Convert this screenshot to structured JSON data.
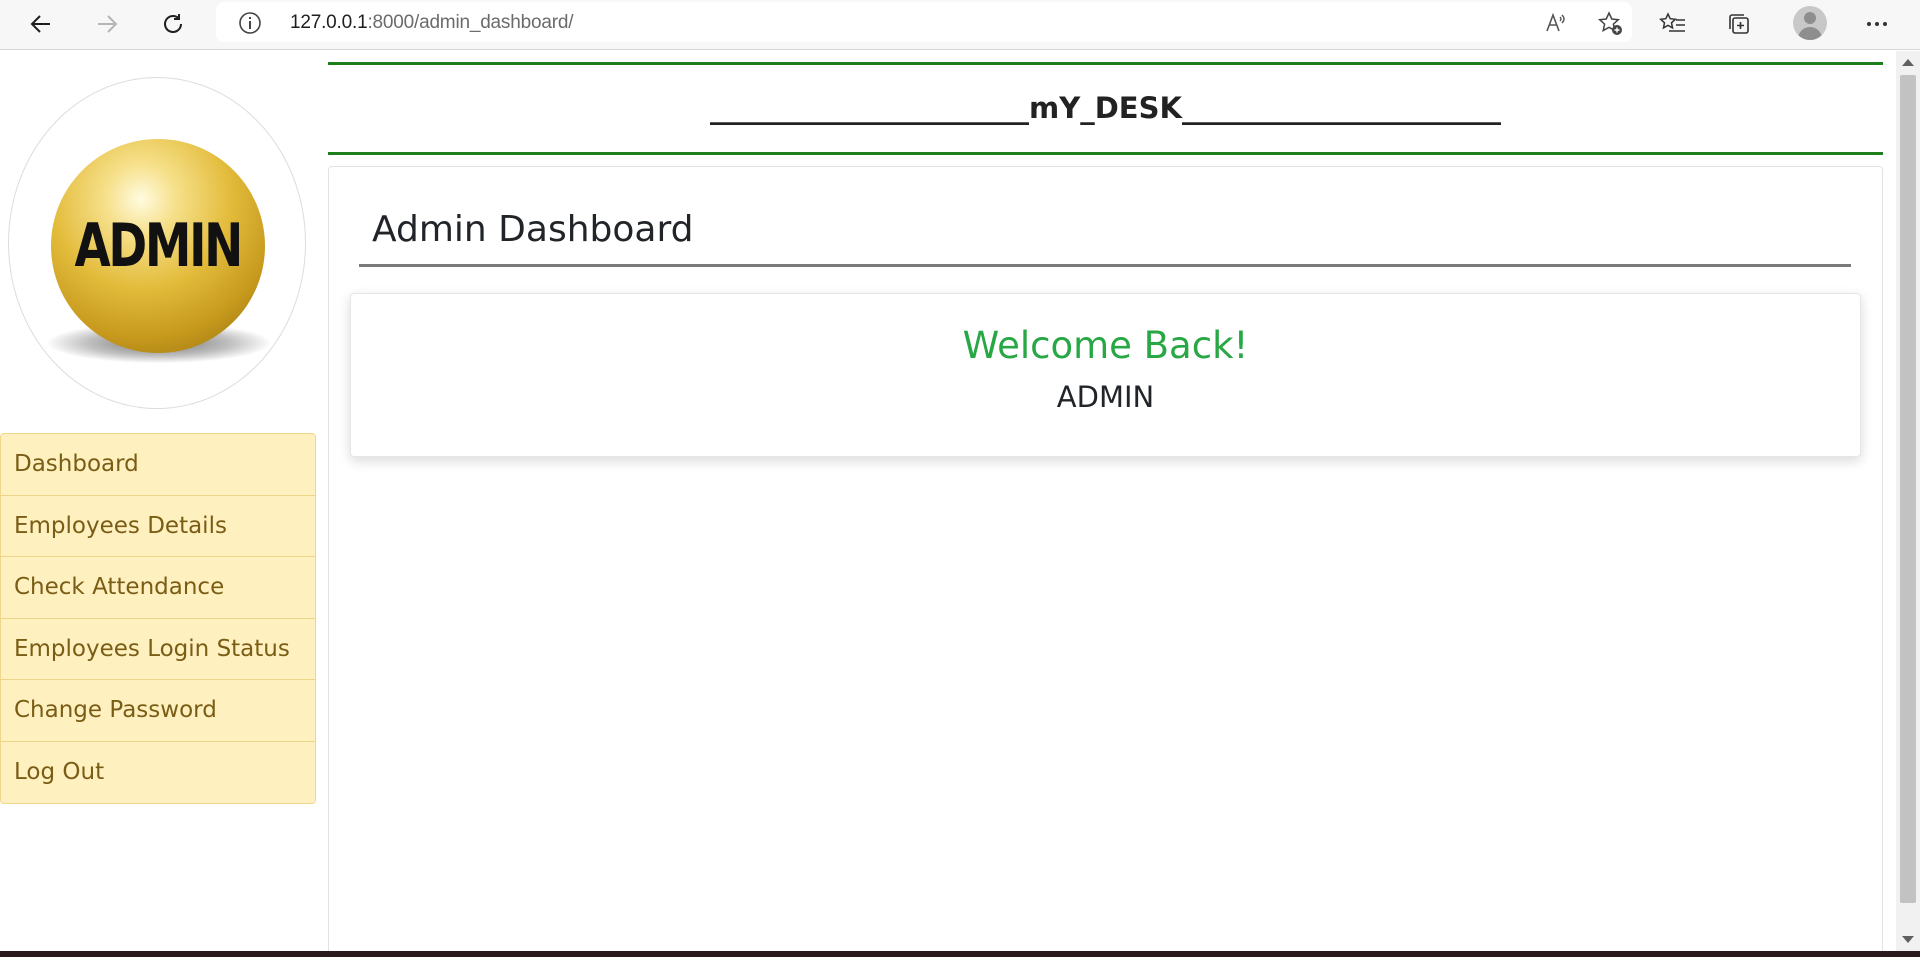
{
  "browser": {
    "url_host": "127.0.0.1",
    "url_rest": ":8000/admin_dashboard/",
    "icons": [
      "back-icon",
      "forward-icon",
      "reload-icon",
      "site-info-icon",
      "read-aloud-icon",
      "add-favorite-icon",
      "favorites-icon",
      "collections-icon",
      "profile-avatar",
      "more-icon"
    ]
  },
  "sidebar": {
    "logo_text": "ADMIN",
    "items": [
      {
        "label": "Dashboard"
      },
      {
        "label": "Employees Details"
      },
      {
        "label": "Check Attendance"
      },
      {
        "label": "Employees Login Status"
      },
      {
        "label": "Change Password"
      },
      {
        "label": "Log Out"
      }
    ],
    "item_bg": "#fff0c0",
    "item_text_color": "#7a5d15"
  },
  "header": {
    "title": "______________________mY_DESK______________________",
    "accent_color": "#1c7f1c"
  },
  "main": {
    "title": "Admin Dashboard",
    "welcome": {
      "heading": "Welcome Back!",
      "name": "ADMIN",
      "heading_color": "#28a745"
    }
  }
}
